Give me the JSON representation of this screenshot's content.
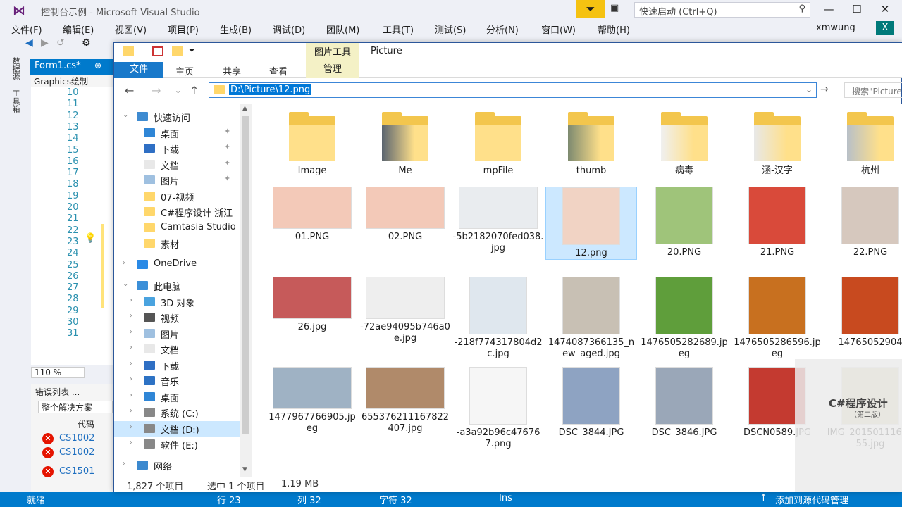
{
  "vs": {
    "title": "控制台示例 - Microsoft Visual Studio",
    "quicklaunch_placeholder": "快速启动 (Ctrl+Q)",
    "menu": [
      "文件(F)",
      "编辑(E)",
      "视图(V)",
      "项目(P)",
      "生成(B)",
      "调试(D)",
      "团队(M)",
      "工具(T)",
      "测试(S)",
      "分析(N)",
      "窗口(W)",
      "帮助(H)"
    ],
    "user": "xmwung",
    "user_badge": "X",
    "sidetabs": [
      "数据源",
      "工具箱"
    ],
    "editor_tab": "Form1.cs*",
    "nav_label": "Graphics绘制",
    "line_numbers": [
      "10",
      "11",
      "12",
      "13",
      "14",
      "15",
      "16",
      "17",
      "18",
      "19",
      "20",
      "21",
      "22",
      "23",
      "24",
      "25",
      "26",
      "27",
      "28",
      "29",
      "30",
      "31"
    ],
    "zoom": "110 %",
    "errlist": {
      "title": "错误列表 ...",
      "scope": "整个解决方案",
      "code_header": "代码",
      "errors": [
        "CS1002",
        "CS1002",
        "CS1501"
      ]
    },
    "status": {
      "ready": "就绪",
      "line": "行 23",
      "col": "列 32",
      "char": "字符 32",
      "mode": "Ins",
      "source_control": "添加到源代码管理"
    }
  },
  "explorer": {
    "ctx_group": "图片工具",
    "title": "Picture",
    "tabs": {
      "file": "文件",
      "home": "主页",
      "share": "共享",
      "view": "查看",
      "manage": "管理"
    },
    "address": "D:\\Picture\\12.png",
    "search_placeholder": "搜索\"Picture\"",
    "nav": [
      {
        "label": "快速访问",
        "kind": "star",
        "level": 0,
        "pin": false
      },
      {
        "label": "桌面",
        "kind": "desk",
        "level": 1,
        "pin": true
      },
      {
        "label": "下载",
        "kind": "down",
        "level": 1,
        "pin": true
      },
      {
        "label": "文档",
        "kind": "doc",
        "level": 1,
        "pin": true
      },
      {
        "label": "图片",
        "kind": "pic",
        "level": 1,
        "pin": true
      },
      {
        "label": "07-视频",
        "kind": "folder",
        "level": 1,
        "pin": false
      },
      {
        "label": "C#程序设计 浙江",
        "kind": "folder",
        "level": 1,
        "pin": false
      },
      {
        "label": "Camtasia Studio",
        "kind": "folder",
        "level": 1,
        "pin": false
      },
      {
        "label": "素材",
        "kind": "folder",
        "level": 1,
        "pin": false
      },
      {
        "label": "OneDrive",
        "kind": "cloud",
        "level": 0,
        "pin": false
      },
      {
        "label": "此电脑",
        "kind": "pc",
        "level": 0,
        "pin": false
      },
      {
        "label": "3D 对象",
        "kind": "cube",
        "level": 1,
        "pin": false
      },
      {
        "label": "视频",
        "kind": "video",
        "level": 1,
        "pin": false
      },
      {
        "label": "图片",
        "kind": "pic",
        "level": 1,
        "pin": false
      },
      {
        "label": "文档",
        "kind": "doc",
        "level": 1,
        "pin": false
      },
      {
        "label": "下载",
        "kind": "down",
        "level": 1,
        "pin": false
      },
      {
        "label": "音乐",
        "kind": "music",
        "level": 1,
        "pin": false
      },
      {
        "label": "桌面",
        "kind": "desk",
        "level": 1,
        "pin": false
      },
      {
        "label": "系统 (C:)",
        "kind": "drive",
        "level": 1,
        "pin": false
      },
      {
        "label": "文档 (D:)",
        "kind": "drive",
        "level": 1,
        "pin": false,
        "selected": true
      },
      {
        "label": "软件 (E:)",
        "kind": "drive",
        "level": 1,
        "pin": false
      },
      {
        "label": "网络",
        "kind": "net",
        "level": 0,
        "pin": false
      }
    ],
    "files": [
      {
        "name": "Image",
        "folder": true,
        "color": "#ffe08a"
      },
      {
        "name": "Me",
        "folder": true,
        "color": "#5a6470"
      },
      {
        "name": "mpFile",
        "folder": true,
        "color": "#ffe08a"
      },
      {
        "name": "thumb",
        "folder": true,
        "color": "#7d8a70"
      },
      {
        "name": "病毒",
        "folder": true,
        "color": "#f0f0f0"
      },
      {
        "name": "涵-汉字",
        "folder": true,
        "color": "#e8e8e8"
      },
      {
        "name": "杭州",
        "folder": true,
        "color": "#b8c0c8"
      },
      {
        "name": "01.PNG",
        "folder": false,
        "color": "#f3c9b8"
      },
      {
        "name": "02.PNG",
        "folder": false,
        "color": "#f3c9b8"
      },
      {
        "name": "-5b2182070fed038.jpg",
        "folder": false,
        "color": "#e9ecef"
      },
      {
        "name": "12.png",
        "folder": false,
        "color": "#f1d3c4",
        "selected": true
      },
      {
        "name": "20.PNG",
        "folder": false,
        "color": "#9fc47a"
      },
      {
        "name": "21.PNG",
        "folder": false,
        "color": "#d94a3a"
      },
      {
        "name": "22.PNG",
        "folder": false,
        "color": "#d6c8be"
      },
      {
        "name": "26.jpg",
        "folder": false,
        "color": "#c65a5a"
      },
      {
        "name": "-72ae94095b746a0e.jpg",
        "folder": false,
        "color": "#eeeeee"
      },
      {
        "name": "-218f774317804d2c.jpg",
        "folder": false,
        "color": "#dfe7ee"
      },
      {
        "name": "1474087366135_new_aged.jpg",
        "folder": false,
        "color": "#c8c0b4"
      },
      {
        "name": "1476505282689.jpeg",
        "folder": false,
        "color": "#5f9e3b"
      },
      {
        "name": "1476505286596.jpeg",
        "folder": false,
        "color": "#c8701f"
      },
      {
        "name": "14765052904",
        "folder": false,
        "color": "#c84a1f"
      },
      {
        "name": "1477967766905.jpeg",
        "folder": false,
        "color": "#9fb2c4"
      },
      {
        "name": "655376211167822407.jpg",
        "folder": false,
        "color": "#b08a6a"
      },
      {
        "name": "-a3a92b96c476767.png",
        "folder": false,
        "color": "#f6f6f6"
      },
      {
        "name": "DSC_3844.JPG",
        "folder": false,
        "color": "#8ea3c2"
      },
      {
        "name": "DSC_3846.JPG",
        "folder": false,
        "color": "#9aa7b8"
      },
      {
        "name": "DSCN0589.JPG",
        "folder": false,
        "color": "#c43a30"
      },
      {
        "name": "IMG_2015011164255.jpg",
        "folder": false,
        "color": "#d8d0a8"
      }
    ],
    "status": {
      "count": "1,827 个项目",
      "selected": "选中 1 个项目",
      "size": "1.19 MB"
    }
  },
  "overlay": {
    "book_title": "C#程序设计",
    "book_sub": "（第二版）"
  }
}
